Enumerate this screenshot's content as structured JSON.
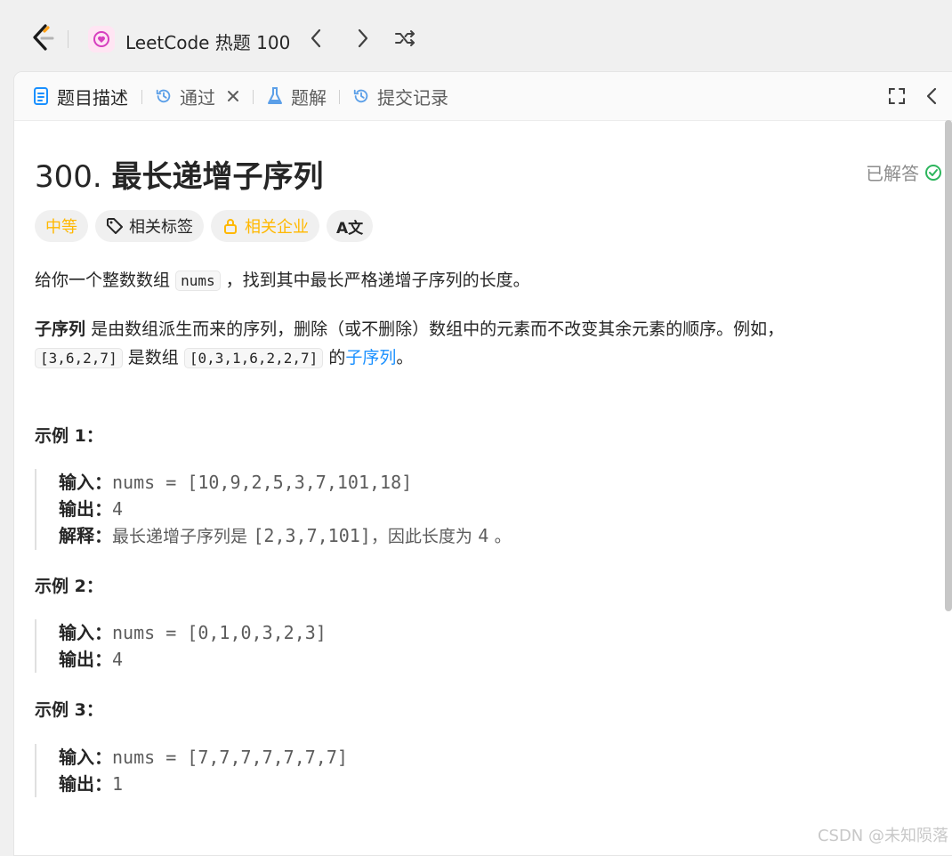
{
  "topbar": {
    "list_title": "LeetCode 热题 100",
    "icons": [
      "leetcode-logo",
      "problem-list-icon",
      "chevron-left-icon",
      "chevron-right-icon",
      "shuffle-icon"
    ]
  },
  "tabs": {
    "description": "题目描述",
    "accepted": "通过",
    "solutions": "题解",
    "submissions": "提交记录"
  },
  "problem": {
    "number": "300.",
    "name": "最长递增子序列",
    "status": "已解答",
    "status_color": "#2db55d",
    "tags": {
      "difficulty": "中等",
      "difficulty_color": "#ffb800",
      "related_tags": "相关标签",
      "related_companies": "相关企业",
      "translate": "A文"
    },
    "desc1_before": "给你一个整数数组",
    "desc1_code": "nums",
    "desc1_after": "，找到其中最长严格递增子序列的长度。",
    "desc2_bold": "子序列",
    "desc2_rest": "是由数组派生而来的序列，删除（或不删除）数组中的元素而不改变其余元素的顺序。例如，",
    "desc3_code1": "[3,6,2,7]",
    "desc3_mid": "是数组",
    "desc3_code2": "[0,3,1,6,2,2,7]",
    "desc3_pre_link": "的",
    "desc3_link": "子序列",
    "desc3_end": "。"
  },
  "examples": [
    {
      "title": "示例 1：",
      "input_label": "输入：",
      "input": "nums = [10,9,2,5,3,7,101,18]",
      "output_label": "输出：",
      "output": "4",
      "explain_label": "解释：",
      "explain_text1": "最长递增子序列是",
      "explain_code": "[2,3,7,101]",
      "explain_text2": "，因此长度为",
      "explain_code2": "4",
      "explain_text3": "。"
    },
    {
      "title": "示例 2：",
      "input_label": "输入：",
      "input": "nums = [0,1,0,3,2,3]",
      "output_label": "输出：",
      "output": "4"
    },
    {
      "title": "示例 3：",
      "input_label": "输入：",
      "input": "nums = [7,7,7,7,7,7,7]",
      "output_label": "输出：",
      "output": "1"
    }
  ],
  "watermark": "CSDN @未知陨落"
}
